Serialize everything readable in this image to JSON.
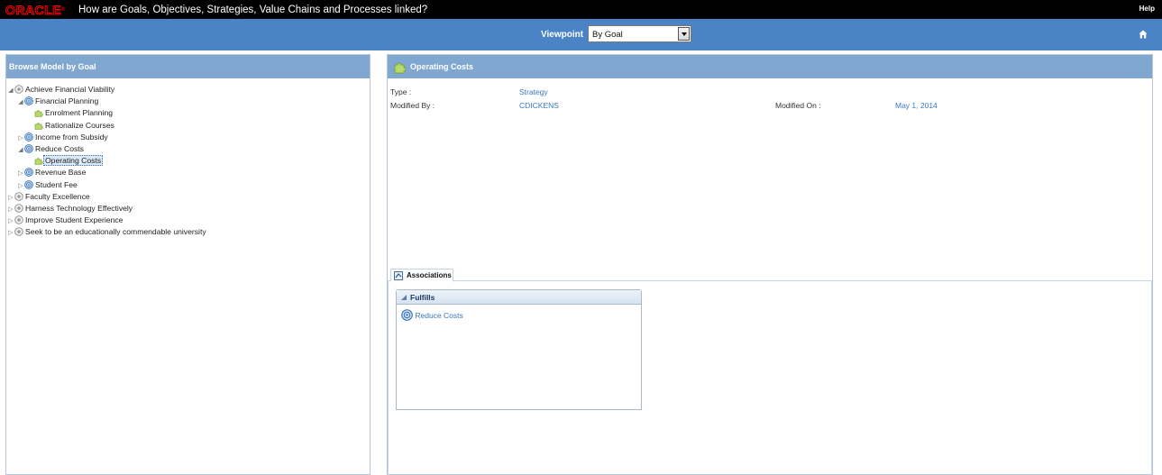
{
  "header": {
    "logo_text": "ORACLE",
    "title": "How are Goals, Objectives, Strategies, Value Chains and Processes linked?",
    "help_label": "Help"
  },
  "viewbar": {
    "viewpoint_label": "Viewpoint",
    "viewpoint_value": "By Goal",
    "home_icon": "home-icon"
  },
  "left_panel": {
    "title": "Browse Model by Goal",
    "tree": [
      {
        "label": "Achieve Financial Viability",
        "level": 0,
        "toggle": "expanded",
        "icon": "goal-icon"
      },
      {
        "label": "Financial Planning",
        "level": 1,
        "toggle": "expanded",
        "icon": "objective-icon"
      },
      {
        "label": "Enrolment Planning",
        "level": 2,
        "toggle": "none",
        "icon": "strategy-icon"
      },
      {
        "label": "Rationalize Courses",
        "level": 2,
        "toggle": "none",
        "icon": "strategy-icon"
      },
      {
        "label": "Income from Subsidy",
        "level": 1,
        "toggle": "collapsed",
        "icon": "objective-icon"
      },
      {
        "label": "Reduce Costs",
        "level": 1,
        "toggle": "expanded",
        "icon": "objective-icon"
      },
      {
        "label": "Operating Costs",
        "level": 2,
        "toggle": "none",
        "icon": "strategy-icon",
        "selected": true
      },
      {
        "label": "Revenue Base",
        "level": 1,
        "toggle": "collapsed",
        "icon": "objective-icon"
      },
      {
        "label": "Student Fee",
        "level": 1,
        "toggle": "collapsed",
        "icon": "objective-icon"
      },
      {
        "label": "Faculty Excellence",
        "level": 0,
        "toggle": "collapsed",
        "icon": "goal-icon"
      },
      {
        "label": "Harness Technology Effectively",
        "level": 0,
        "toggle": "collapsed",
        "icon": "goal-icon"
      },
      {
        "label": "Improve Student Experience",
        "level": 0,
        "toggle": "collapsed",
        "icon": "goal-icon"
      },
      {
        "label": "Seek to be an educationally commendable university",
        "level": 0,
        "toggle": "collapsed",
        "icon": "goal-icon"
      }
    ]
  },
  "right_panel": {
    "title": "Operating Costs",
    "type_label": "Type :",
    "type_value": "Strategy",
    "modified_by_label": "Modified By :",
    "modified_by_value": "CDICKENS",
    "modified_on_label": "Modified On :",
    "modified_on_value": "May 1, 2014",
    "tabs": [
      {
        "label": "Associations",
        "active": true
      }
    ],
    "associations": {
      "section_title": "Fulfills",
      "items": [
        {
          "label": "Reduce Costs",
          "icon": "objective-icon"
        }
      ]
    }
  },
  "colors": {
    "top_bar": "#000000",
    "view_bar": "#4a84c6",
    "panel_header": "#7fa7d0",
    "link": "#3a78c0",
    "oracle_red": "#ff0000"
  }
}
